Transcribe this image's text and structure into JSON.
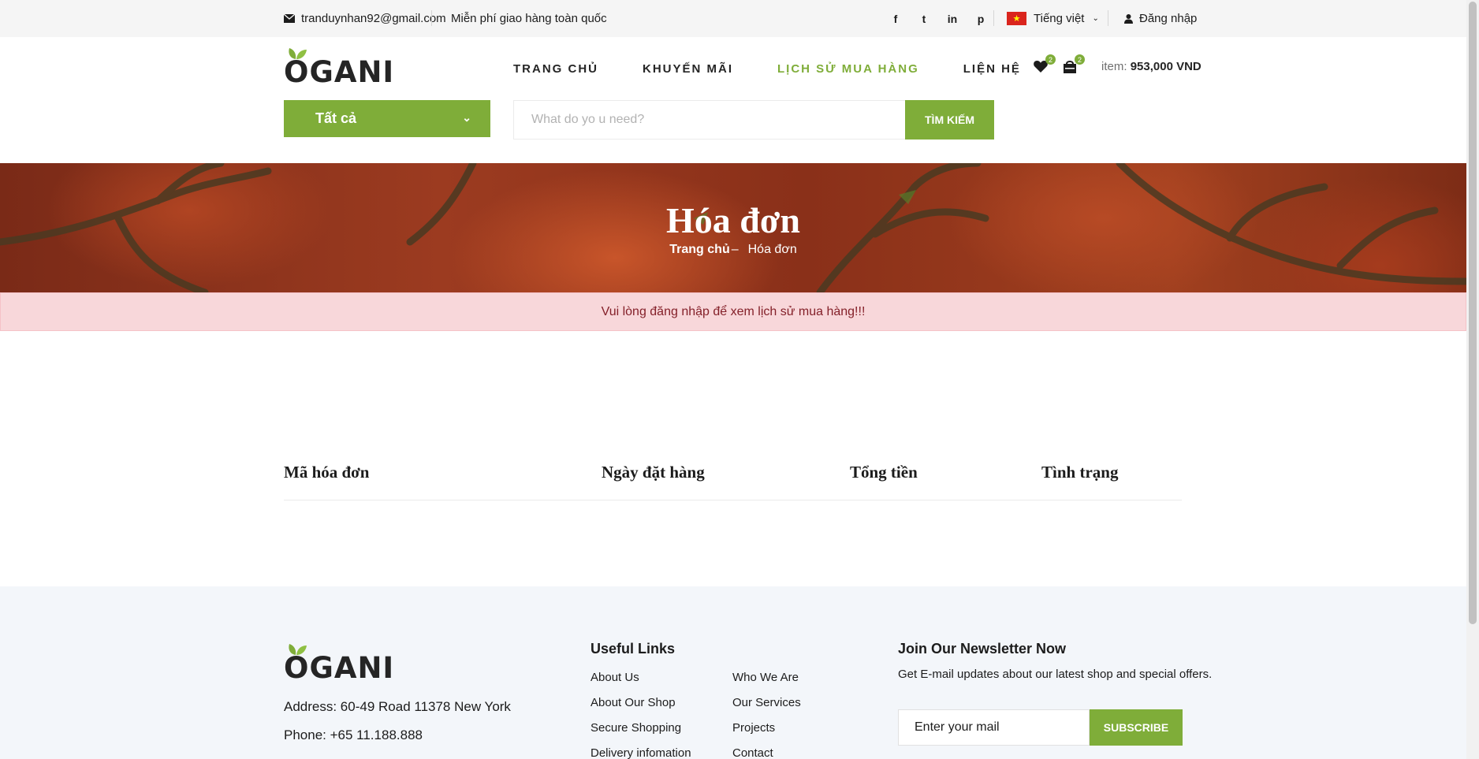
{
  "topbar": {
    "email": "tranduynhan92@gmail.com",
    "shipping": "Miễn phí giao hàng toàn quốc",
    "social": [
      "f",
      "t",
      "in",
      "p"
    ],
    "language": "Tiếng việt",
    "login": "Đăng nhập"
  },
  "header": {
    "logo": "OGANI",
    "nav": [
      "TRANG CHỦ",
      "KHUYẾN MÃI",
      "LỊCH SỬ MUA HÀNG",
      "LIỆN HỆ"
    ],
    "active_nav": "LỊCH SỬ MUA HÀNG",
    "wishlist_count": "2",
    "cart_count": "2",
    "cart_total_label": "item:",
    "cart_total_value": "953,000 VND"
  },
  "category": {
    "label": "Tất cả"
  },
  "search": {
    "placeholder": "What do yo u need?",
    "button": "TÌM KIẾM"
  },
  "hero": {
    "title": "Hóa đơn",
    "breadcrumb_home": "Trang chủ",
    "breadcrumb_sep": "–",
    "breadcrumb_current": "Hóa đơn"
  },
  "alert": {
    "message": "Vui lòng đăng nhập để xem lịch sử mua hàng!!!"
  },
  "table": {
    "columns": [
      "Mã hóa đơn",
      "Ngày đặt hàng",
      "Tổng tiền",
      "Tình trạng"
    ]
  },
  "footer": {
    "logo": "OGANI",
    "address": "Address: 60-49 Road 11378 New York",
    "phone": "Phone: +65 11.188.888",
    "useful_links_title": "Useful Links",
    "links_col1": [
      "About Us",
      "About Our Shop",
      "Secure Shopping",
      "Delivery infomation"
    ],
    "links_col2": [
      "Who We Are",
      "Our Services",
      "Projects",
      "Contact"
    ],
    "newsletter_title": "Join Our Newsletter Now",
    "newsletter_text": "Get E-mail updates about our latest shop and special offers.",
    "newsletter_placeholder": "Enter your mail",
    "subscribe": "SUBSCRIBE"
  },
  "colors": {
    "accent": "#7fad39",
    "alert_bg": "#f8d7da",
    "alert_text": "#842029",
    "footer_bg": "#f3f6fa"
  }
}
